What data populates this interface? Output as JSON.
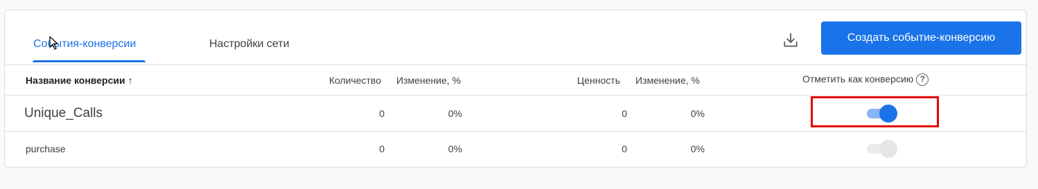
{
  "tabs": {
    "conversion_events": "События-конверсии",
    "network_settings": "Настройки сети"
  },
  "toolbar": {
    "download_icon": "download-icon",
    "create_button": "Создать событие-конверсию"
  },
  "table": {
    "headers": {
      "name": "Название конверсии",
      "count": "Количество",
      "count_change": "Изменение, %",
      "value": "Ценность",
      "value_change": "Изменение, %",
      "mark": "Отметить как конверсию"
    },
    "sort_arrow": "↑",
    "help_icon": "?",
    "rows": [
      {
        "name": "Unique_Calls",
        "count": "0",
        "count_change": "0%",
        "value": "0",
        "value_change": "0%",
        "is_conversion": true
      },
      {
        "name": "purchase",
        "count": "0",
        "count_change": "0%",
        "value": "0",
        "value_change": "0%",
        "is_conversion": false
      }
    ]
  },
  "colors": {
    "accent": "#1a73e8",
    "highlight_box": "#e00000"
  }
}
